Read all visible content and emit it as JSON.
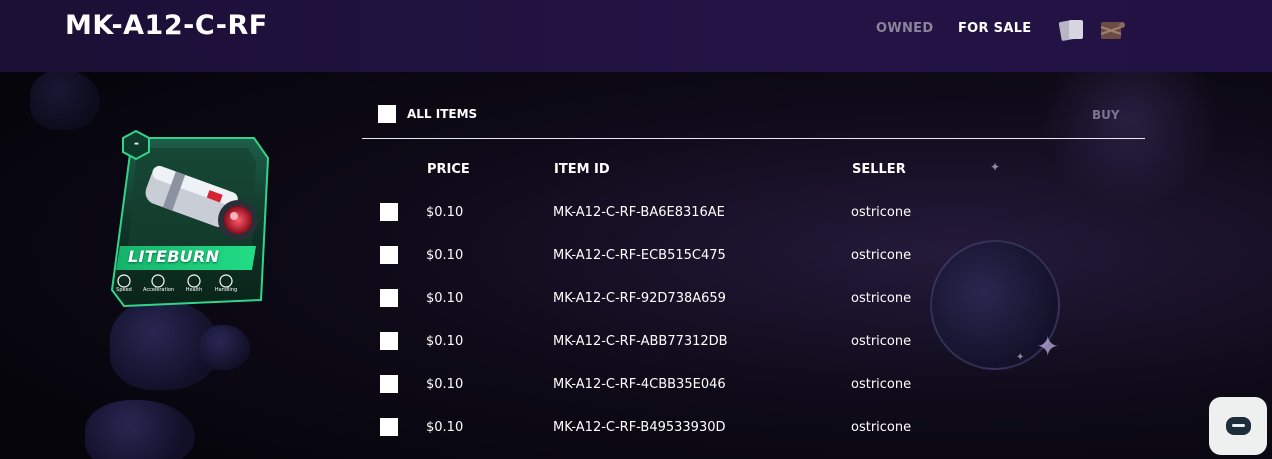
{
  "header": {
    "title": "MK-A12-C-RF",
    "nav": {
      "owned": "OWNED",
      "for_sale": "FOR SALE"
    },
    "icons": [
      "cards-icon",
      "inventory-crate-icon"
    ]
  },
  "card": {
    "badge": "-",
    "name": "LITEBURN",
    "stats": [
      "Speed",
      "Acceleration",
      "Health",
      "Handling"
    ],
    "accent_color": "#22c77a"
  },
  "table": {
    "select_all_label": "ALL ITEMS",
    "buy_label": "BUY",
    "columns": {
      "price": "PRICE",
      "item_id": "ITEM ID",
      "seller": "SELLER"
    },
    "rows": [
      {
        "price": "$0.10",
        "item_id": "MK-A12-C-RF-BA6E8316AE",
        "seller": "ostricone"
      },
      {
        "price": "$0.10",
        "item_id": "MK-A12-C-RF-ECB515C475",
        "seller": "ostricone"
      },
      {
        "price": "$0.10",
        "item_id": "MK-A12-C-RF-92D738A659",
        "seller": "ostricone"
      },
      {
        "price": "$0.10",
        "item_id": "MK-A12-C-RF-ABB77312DB",
        "seller": "ostricone"
      },
      {
        "price": "$0.10",
        "item_id": "MK-A12-C-RF-4CBB35E046",
        "seller": "ostricone"
      },
      {
        "price": "$0.10",
        "item_id": "MK-A12-C-RF-B49533930D",
        "seller": "ostricone"
      }
    ]
  },
  "chat": {
    "icon": "chat-icon"
  },
  "colors": {
    "header_bg": "#1f1240",
    "page_bg": "#06050c",
    "muted_text": "#8a8598"
  }
}
